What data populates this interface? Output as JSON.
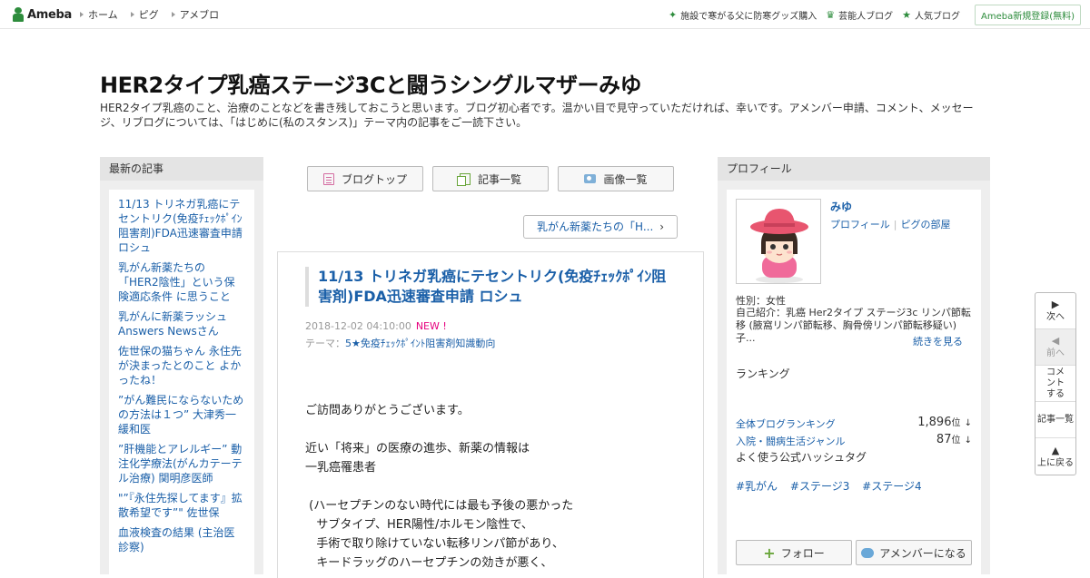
{
  "topbar": {
    "logo": "Ameba",
    "nav": [
      "ホーム",
      "ピグ",
      "アメブロ"
    ],
    "right_links": [
      {
        "icon": "sparkle-icon",
        "label": "施設で寒がる父に防寒グッズ購入"
      },
      {
        "icon": "crown-icon",
        "label": "芸能人ブログ"
      },
      {
        "icon": "star-icon",
        "label": "人気ブログ"
      }
    ],
    "register": "Ameba新規登録(無料)"
  },
  "header": {
    "title": "HER2タイプ乳癌ステージ3Cと闘うシングルマザーみゆ",
    "description": "HER2タイプ乳癌のこと、治療のことなどを書き残しておこうと思います。ブログ初心者です。温かい目で見守っていただければ、幸いです。アメンバー申請、コメント、メッセージ、リブログについては、「はじめに(私のスタンス)」テーマ内の記事をご一読下さい。"
  },
  "left_sidebar": {
    "heading": "最新の記事",
    "items": [
      "11/13 トリネガ乳癌にテセントリク(免疫ﾁｪｯｸﾎﾟｲﾝ阻害剤)FDA迅速審査申請 ロシュ",
      "乳がん新薬たちの「HER2陰性」という保険適応条件 に思うこと",
      "乳がんに新薬ラッシュ Answers Newsさん",
      "佐世保の猫ちゃん 永住先が決まったとのこと よかったね！",
      "”がん難民にならないための方法は１つ” 大津秀一緩和医",
      "”肝機能とアレルギー” 動注化学療法(がんカテーテル治療) 関明彦医師",
      "\"”『永住先探してます』拡散希望です”\" 佐世保",
      "血液検査の結果 (主治医診察)"
    ]
  },
  "center": {
    "buttons": [
      "ブログトップ",
      "記事一覧",
      "画像一覧"
    ],
    "prev_link": "乳がん新薬たちの「H...",
    "article": {
      "title": "11/13 トリネガ乳癌にテセントリク(免疫ﾁｪｯｸﾎﾟｲﾝ阻害剤)FDA迅速審査申請 ロシュ",
      "datetime": "2018-12-02 04:10:00",
      "new_badge": "NEW !",
      "theme_label": "テーマ：",
      "theme": "5★免疫ﾁｪｯｸﾎﾟｲﾝﾄ阻害剤知識動向",
      "body": "ご訪問ありがとうございます。\n\n近い「将来」の医療の進歩、新薬の情報は\n一乳癌罹患者\n\n (ハーセプチンのない時代には最も予後の悪かった\n   サブタイプ、HER陽性/ホルモン陰性で、\n   手術で取り除けていない転移リンパ節があり、\n   キードラッグのハーセプチンの効きが悪く、"
    }
  },
  "right_sidebar": {
    "heading": "プロフィール",
    "name": "みゆ",
    "links": [
      "プロフィール",
      "ピグの部屋"
    ],
    "gender": "性別：女性",
    "intro": "自己紹介：乳癌 Her2タイプ ステージ3c リンパ節転移 (腋窩リンパ節転移、胸骨傍リンパ節転移疑い) 子...",
    "more": "続きを見る",
    "ranking_heading": "ランキング",
    "rankings": [
      {
        "name": "全体ブログランキング",
        "value": "1,896",
        "unit": "位",
        "trend": "↓"
      },
      {
        "name": "入院・闘病生活ジャンル",
        "value": "87",
        "unit": "位",
        "trend": "↓"
      }
    ],
    "hashtag_heading": "よく使う公式ハッシュタグ",
    "hashtags": [
      "#乳がん",
      "#ステージ3",
      "#ステージ4"
    ],
    "follow": "フォロー",
    "member": "アメンバーになる"
  },
  "floatnav": [
    {
      "icon": "next-arrow-icon",
      "label": "次へ",
      "glyph": "▶"
    },
    {
      "icon": "prev-arrow-icon",
      "label": "前へ",
      "glyph": "◀"
    },
    {
      "icon": "",
      "label": "コメントする",
      "glyph": ""
    },
    {
      "icon": "",
      "label": "記事一覧",
      "glyph": ""
    },
    {
      "icon": "up-arrow-icon",
      "label": "上に戻る",
      "glyph": "▲"
    }
  ],
  "colors": {
    "brand_green": "#2d8c3c",
    "link_blue": "#1a5fa8",
    "new_pink": "#e6007e"
  }
}
